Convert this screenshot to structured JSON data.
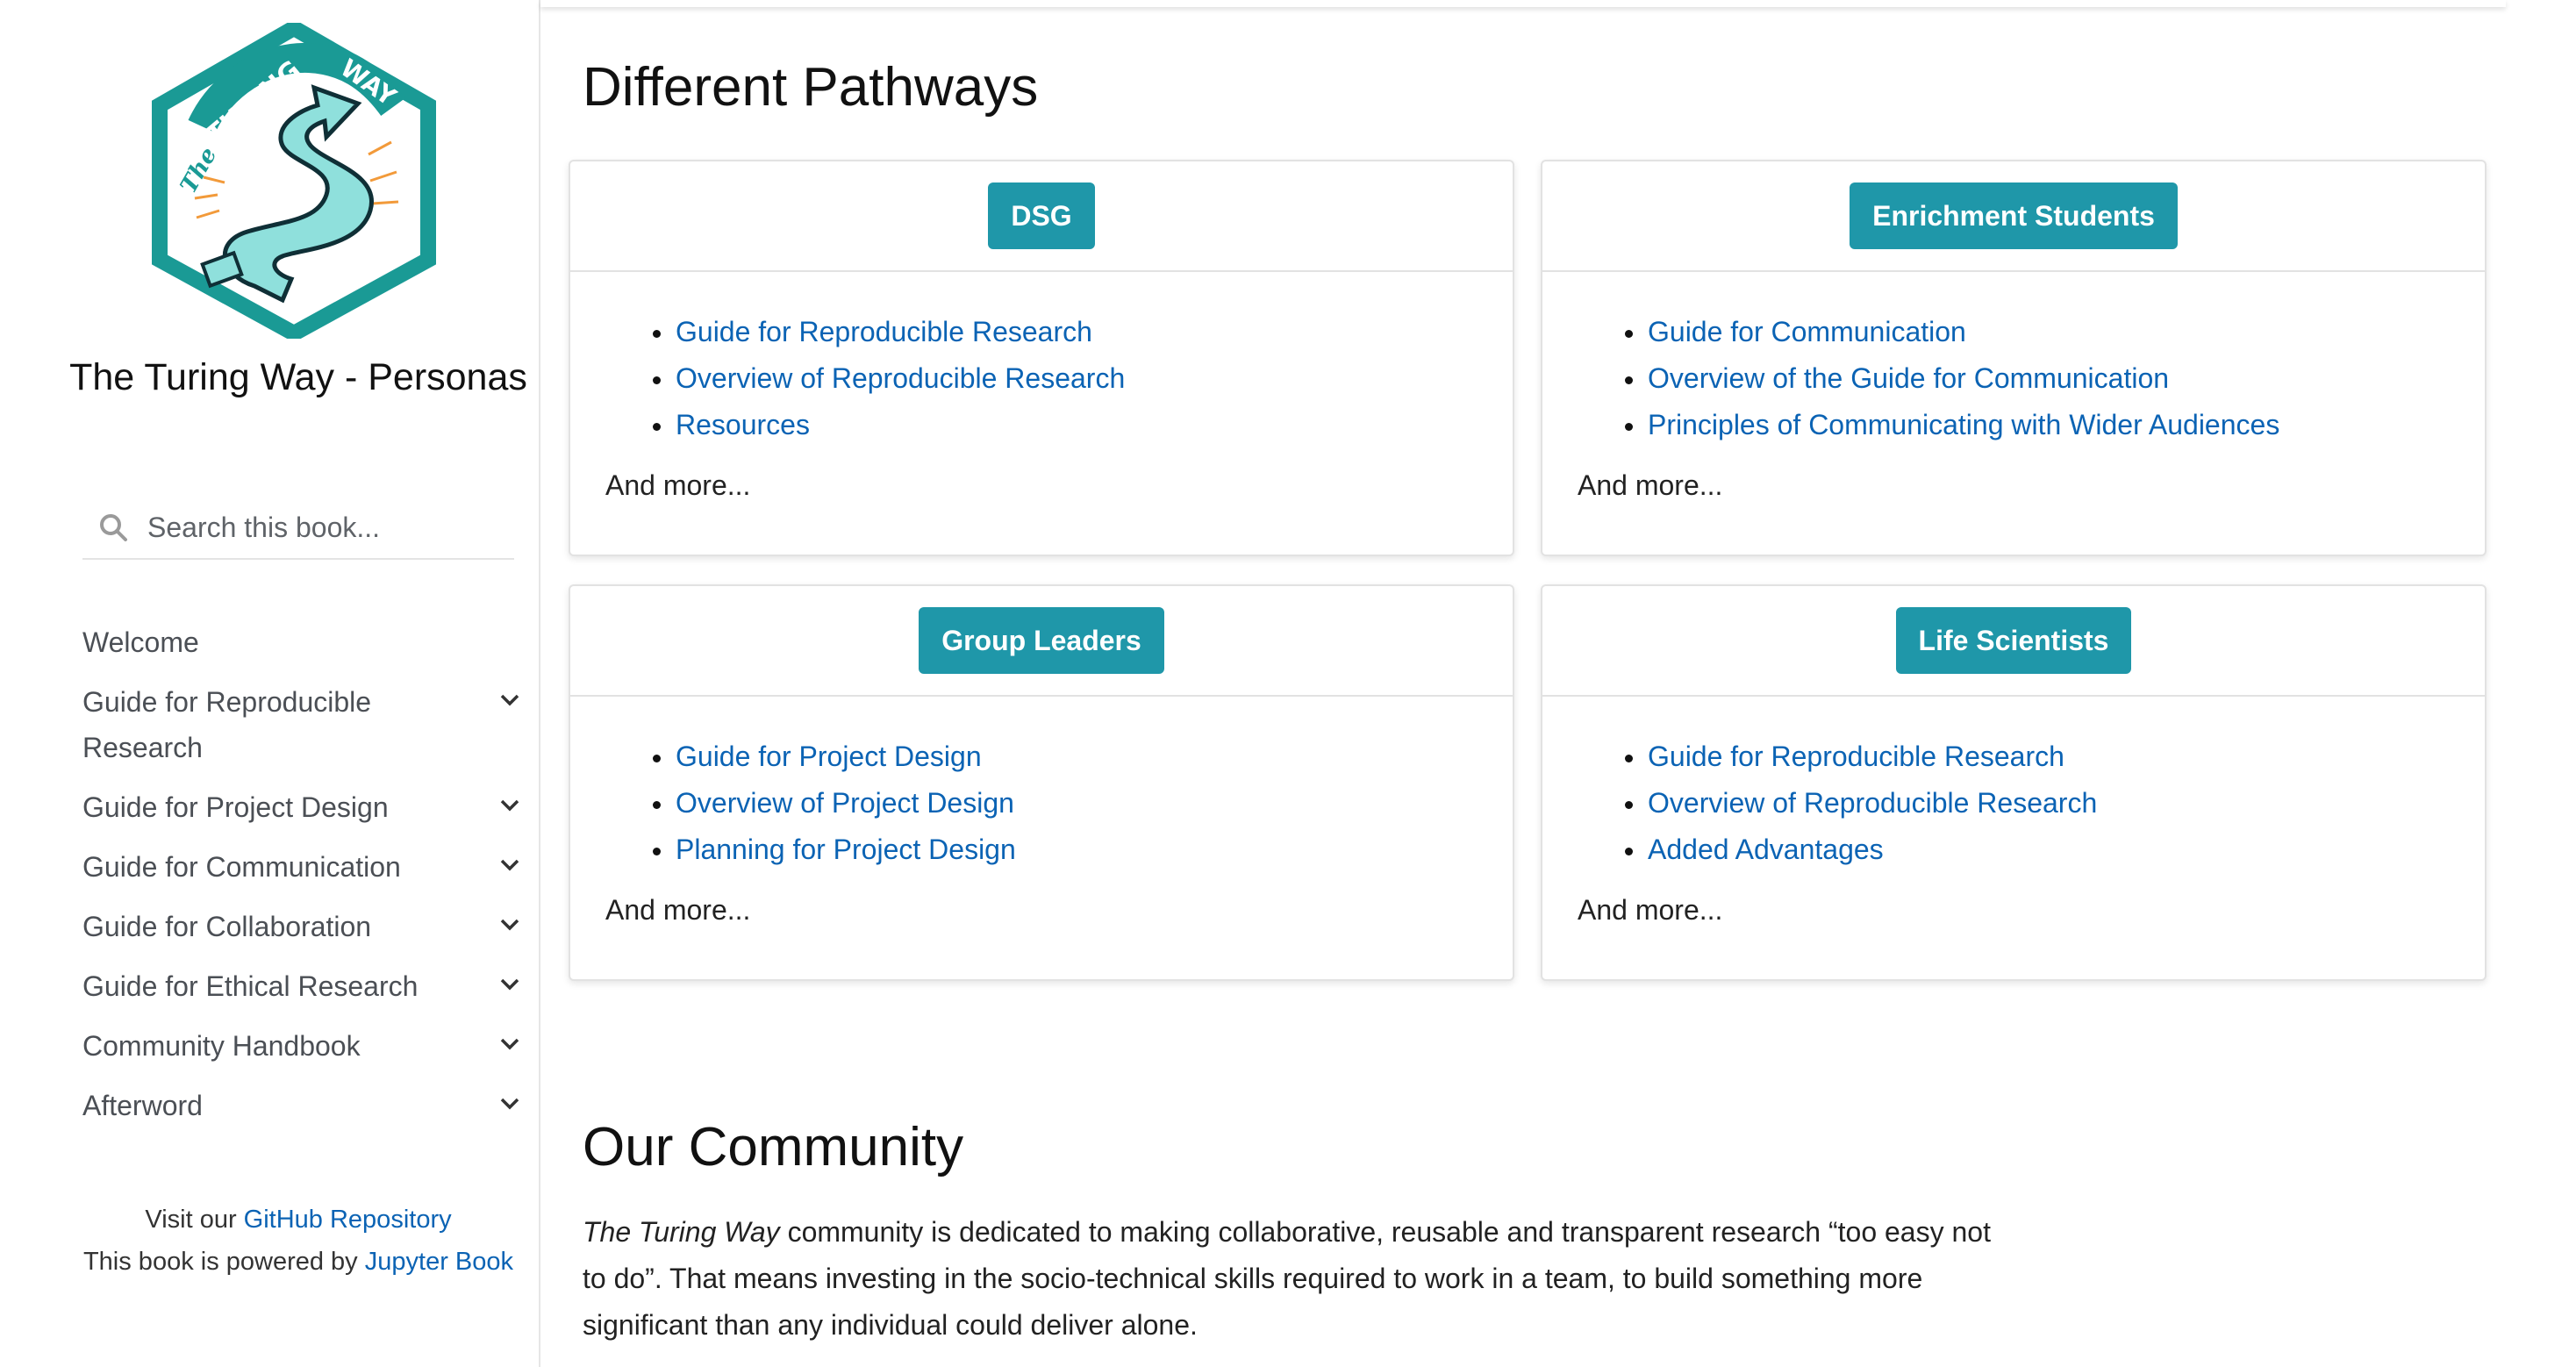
{
  "sidebar": {
    "logo": {
      "text_line_1": "The",
      "text_line_2": "TURING WAY"
    },
    "book_title": "The Turing Way - Personas",
    "search": {
      "placeholder": "Search this book..."
    },
    "nav": [
      {
        "label": "Welcome",
        "expandable": false
      },
      {
        "label": "Guide for Reproducible Research",
        "expandable": true
      },
      {
        "label": "Guide for Project Design",
        "expandable": true
      },
      {
        "label": "Guide for Communication",
        "expandable": true
      },
      {
        "label": "Guide for Collaboration",
        "expandable": true
      },
      {
        "label": "Guide for Ethical Research",
        "expandable": true
      },
      {
        "label": "Community Handbook",
        "expandable": true
      },
      {
        "label": "Afterword",
        "expandable": true
      }
    ],
    "footer": {
      "visit_prefix": "Visit our ",
      "github_link": "GitHub Repository",
      "powered_prefix": "This book is powered by ",
      "jupyter_link": "Jupyter Book"
    }
  },
  "main": {
    "pathways_heading": "Different Pathways",
    "cards": [
      {
        "button": "DSG",
        "links": [
          "Guide for Reproducible Research",
          "Overview of Reproducible Research",
          "Resources"
        ],
        "more": "And more..."
      },
      {
        "button": "Enrichment Students",
        "links": [
          "Guide for Communication",
          "Overview of the Guide for Communication",
          "Principles of Communicating with Wider Audiences"
        ],
        "more": "And more..."
      },
      {
        "button": "Group Leaders",
        "links": [
          "Guide for Project Design",
          "Overview of Project Design",
          "Planning for Project Design"
        ],
        "more": "And more..."
      },
      {
        "button": "Life Scientists",
        "links": [
          "Guide for Reproducible Research",
          "Overview of Reproducible Research",
          "Added Advantages"
        ],
        "more": "And more..."
      }
    ],
    "community_heading": "Our Community",
    "community_text": {
      "italic": "The Turing Way",
      "rest": " community is dedicated to making collaborative, reusable and transparent research “too easy not to do”. That means investing in the socio-technical skills required to work in a team, to build something more significant than any individual could deliver alone."
    }
  },
  "colors": {
    "accent": "#1f97a9",
    "link": "#0b63b4",
    "logo_teal": "#1a9a95",
    "logo_mint": "#8fe0dc"
  }
}
